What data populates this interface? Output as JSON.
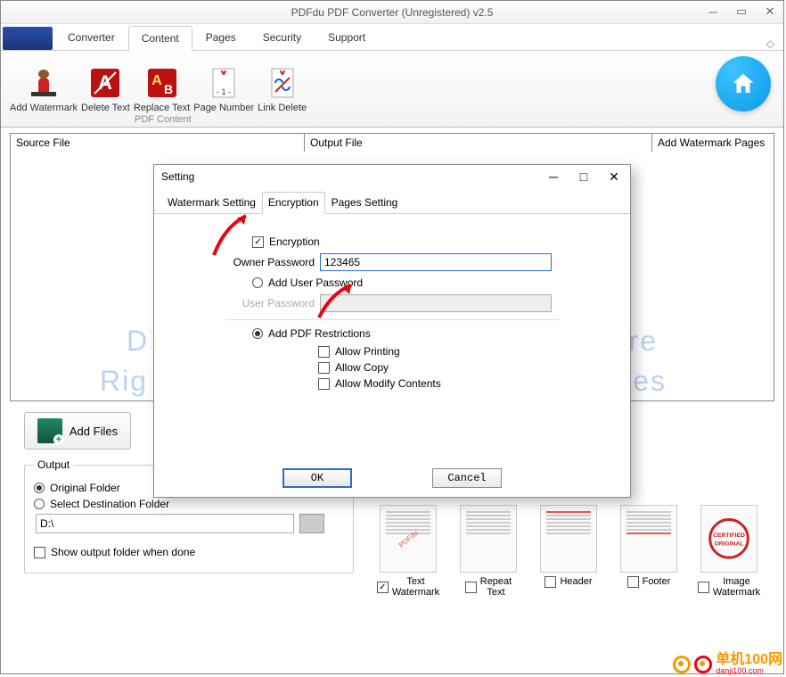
{
  "window": {
    "title": "PDFdu PDF Converter (Unregistered) v2.5"
  },
  "tabs": {
    "converter": "Converter",
    "content": "Content",
    "pages": "Pages",
    "security": "Security",
    "support": "Support"
  },
  "ribbon": {
    "add_watermark": "Add Watermark",
    "delete_text": "Delete Text",
    "replace_text": "Replace Text",
    "page_number": "Page Number",
    "link_delete": "Link Delete",
    "group_label": "PDF Content"
  },
  "columns": {
    "source": "Source File",
    "output": "Output File",
    "watermark_pages": "Add Watermark Pages"
  },
  "bg_text_1": "D",
  "bg_text_2": "re",
  "bg_text_3": "Rig",
  "bg_text_4": "es",
  "add_files": "Add Files",
  "output": {
    "legend": "Output",
    "original_folder": "Original Folder",
    "select_dest": "Select Destination Folder",
    "path": "D:\\",
    "show_when_done": "Show output folder when done"
  },
  "thumbs": {
    "text_wm": "Text\nWatermark",
    "repeat_text": "Repeat\nText",
    "header": "Header",
    "footer": "Footer",
    "image_wm": "Image\nWatermark"
  },
  "dialog": {
    "title": "Setting",
    "tab_watermark": "Watermark Setting",
    "tab_encryption": "Encryption",
    "tab_pages": "Pages Setting",
    "encryption_chk": "Encryption",
    "owner_pw_label": "Owner Password",
    "owner_pw_value": "123465",
    "add_user_pw": "Add User Password",
    "user_pw_label": "User Password",
    "add_restrictions": "Add PDF Restrictions",
    "allow_print": "Allow Printing",
    "allow_copy": "Allow Copy",
    "allow_modify": "Allow Modify Contents",
    "ok": "OK",
    "cancel": "Cancel"
  },
  "footer": {
    "name": "单机100网",
    "url": "danji100.com"
  }
}
